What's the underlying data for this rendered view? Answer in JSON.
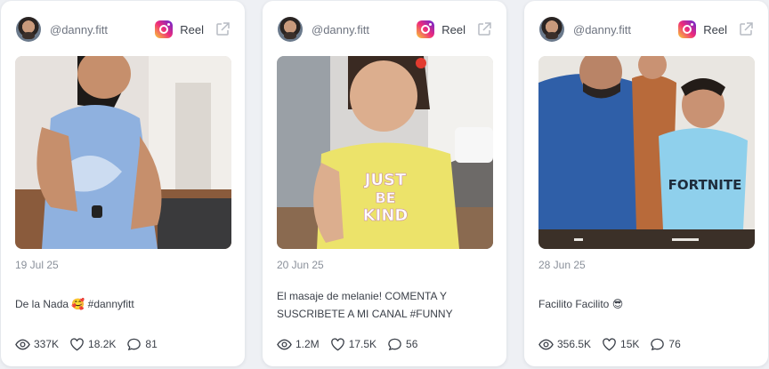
{
  "posts": [
    {
      "handle": "@danny.fitt",
      "type": "Reel",
      "date": "19 Jul 25",
      "caption": "De la Nada 🥰 #dannyfitt",
      "views": "337K",
      "likes": "18.2K",
      "comments": "81"
    },
    {
      "handle": "@danny.fitt",
      "type": "Reel",
      "date": "20 Jun 25",
      "caption": "El masaje de melanie! COMENTA Y SUSCRIBETE A MI CANAL #FUNNY #SHORT...",
      "views": "1.2M",
      "likes": "17.5K",
      "comments": "56"
    },
    {
      "handle": "@danny.fitt",
      "type": "Reel",
      "date": "28 Jun 25",
      "caption": "Facilito Facilito 😎",
      "views": "356.5K",
      "likes": "15K",
      "comments": "76"
    }
  ],
  "icons": {
    "platform": "instagram-icon",
    "external": "external-link-icon",
    "views": "eye-icon",
    "likes": "heart-icon",
    "comments": "comment-icon"
  },
  "colors": {
    "page_bg": "#eef0f4",
    "card_bg": "#ffffff",
    "muted_text": "#8a909a",
    "body_text": "#3b4049"
  }
}
